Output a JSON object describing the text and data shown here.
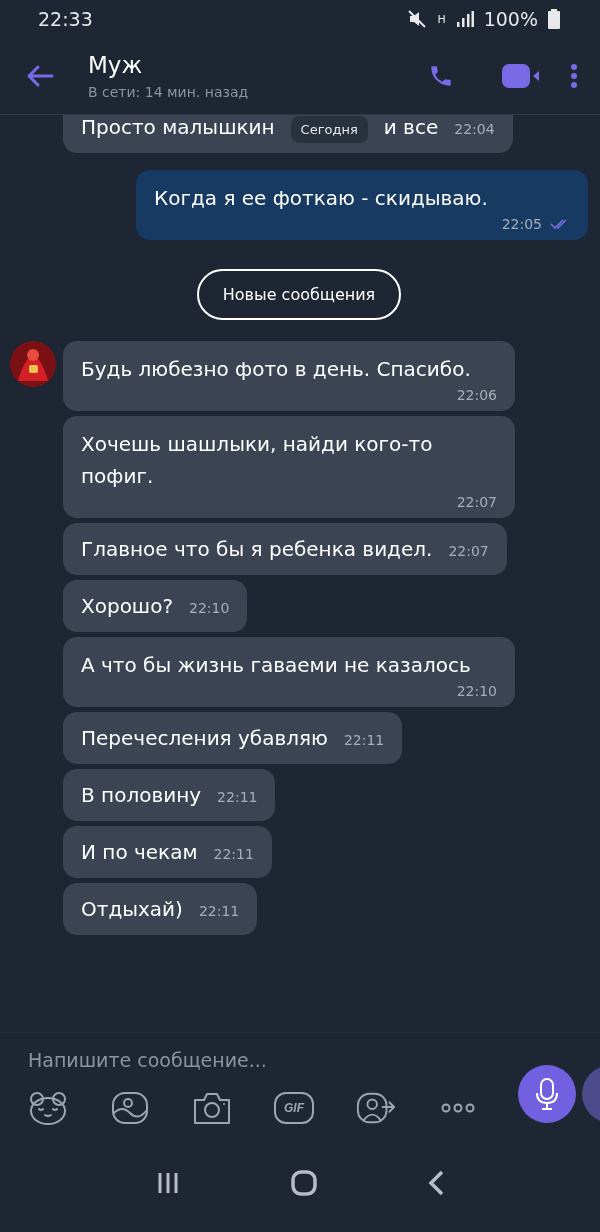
{
  "status_bar": {
    "time": "22:33",
    "network": "H",
    "battery": "100%"
  },
  "header": {
    "title": "Муж",
    "subtitle": "В сети: 14 мин. назад"
  },
  "items": [
    {
      "kind": "incoming",
      "time_below": false,
      "avatar": false,
      "text": "Просто малышкин",
      "text_after": "и все",
      "overlay": "Сегодня",
      "time": "22:04"
    },
    {
      "kind": "outgoing",
      "time_below": true,
      "text": "Когда я ее фоткаю - скидываю.",
      "time": "22:05",
      "read": true
    },
    {
      "kind": "divider",
      "text": "Новые сообщения"
    },
    {
      "kind": "incoming",
      "time_below": true,
      "avatar": true,
      "text": "Будь любезно фото в день. Спасибо.",
      "time": "22:06"
    },
    {
      "kind": "incoming",
      "time_below": true,
      "avatar": false,
      "text": "Хочешь шашлыки, найди кого-то пофиг.",
      "time": "22:07"
    },
    {
      "kind": "incoming",
      "time_below": false,
      "avatar": false,
      "text": "Главное что бы я ребенка видел.",
      "time": "22:07"
    },
    {
      "kind": "incoming",
      "time_below": false,
      "avatar": false,
      "text": "Хорошо?",
      "time": "22:10"
    },
    {
      "kind": "incoming",
      "time_below": true,
      "avatar": false,
      "text": "А что бы жизнь гаваеми не казалось",
      "time": "22:10"
    },
    {
      "kind": "incoming",
      "time_below": false,
      "avatar": false,
      "text": "Перечесления убавляю",
      "time": "22:11"
    },
    {
      "kind": "incoming",
      "time_below": false,
      "avatar": false,
      "text": "В половину",
      "time": "22:11"
    },
    {
      "kind": "incoming",
      "time_below": false,
      "avatar": false,
      "text": "И по чекам",
      "time": "22:11"
    },
    {
      "kind": "incoming",
      "time_below": false,
      "avatar": false,
      "text": "Отдыхай)",
      "time": "22:11"
    }
  ],
  "composer": {
    "placeholder": "Напишите сообщение...",
    "gif_label": "GIF"
  }
}
